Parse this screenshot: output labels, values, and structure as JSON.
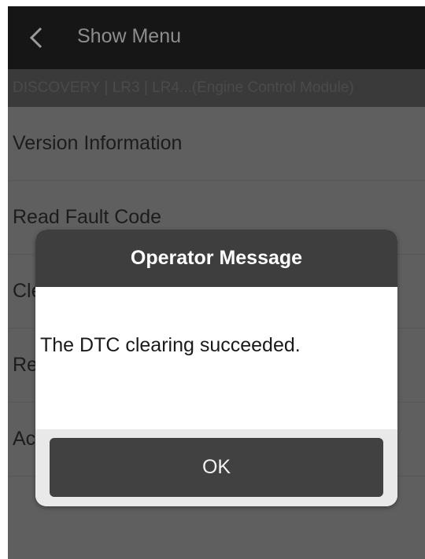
{
  "header": {
    "back_icon": "chevron-left-icon",
    "title": "Show Menu"
  },
  "breadcrumb": "DISCOVERY | LR3 | LR4...(Engine Control Module)",
  "menu": {
    "items": [
      {
        "label": "Version Information"
      },
      {
        "label": "Read Fault Code"
      },
      {
        "label": "Cle"
      },
      {
        "label": "Re"
      },
      {
        "label": "Ac"
      },
      {
        "label": ""
      }
    ]
  },
  "dialog": {
    "title": "Operator Message",
    "message": "The DTC clearing succeeded.",
    "ok_label": "OK"
  },
  "colors": {
    "topbar": "#161616",
    "breadcrumb_bg": "#3a3a3a",
    "screen_dim": "#5f5f5f",
    "dialog_header": "#3e3e3e",
    "ok_button": "#414141"
  }
}
